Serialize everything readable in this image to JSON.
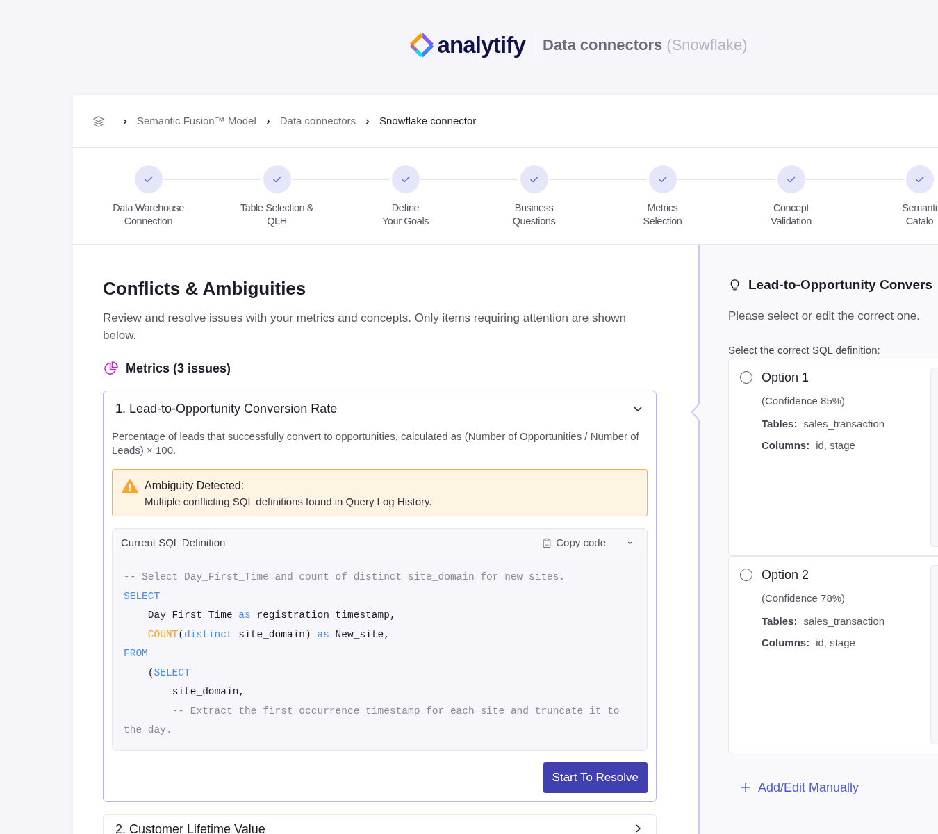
{
  "header": {
    "brand": "analytify",
    "title": "Data connectors",
    "subtitle": "(Snowflake)"
  },
  "breadcrumb": [
    "Semantic Fusion™ Model",
    "Data connectors",
    "Snowflake connector"
  ],
  "steps": [
    {
      "lines": [
        "Data Warehouse",
        "Connection"
      ],
      "completed": true
    },
    {
      "lines": [
        "Table Selection &",
        "QLH"
      ],
      "completed": true
    },
    {
      "lines": [
        "Define",
        "Your Goals"
      ],
      "completed": true
    },
    {
      "lines": [
        "Business",
        "Questions"
      ],
      "completed": true
    },
    {
      "lines": [
        "Metrics",
        "Selection"
      ],
      "completed": true
    },
    {
      "lines": [
        "Concept",
        "Validation"
      ],
      "completed": true
    },
    {
      "lines": [
        "Semanti",
        "Catalo"
      ],
      "completed": true
    }
  ],
  "main": {
    "title": "Conflicts & Ambiguities",
    "description": "Review and resolve issues with your metrics and concepts. Only items requiring attention are shown below.",
    "section": "Metrics (3 issues)",
    "metrics": [
      {
        "title": "1. Lead-to-Opportunity Conversion Rate",
        "expanded": true,
        "description": "Percentage of leads that successfully convert to opportunities, calculated as (Number of Opportunities / Number of Leads) × 100.",
        "alert": {
          "title": "Ambiguity Detected:",
          "message": "Multiple conflicting SQL definitions found in Query Log History."
        },
        "sql": {
          "label": "Current SQL Definition",
          "copy": "Copy code",
          "lines": [
            [
              {
                "kind": "comment",
                "text": "-- Select Day_First_Time and count of distinct site_domain for new sites."
              }
            ],
            [
              {
                "kind": "keyword",
                "text": "SELECT"
              }
            ],
            [
              {
                "kind": "plain",
                "text": "    Day_First_Time "
              },
              {
                "kind": "keyword",
                "text": "as"
              },
              {
                "kind": "plain",
                "text": " registration_timestamp,"
              }
            ],
            [
              {
                "kind": "function",
                "text": "    COUNT"
              },
              {
                "kind": "plain",
                "text": "("
              },
              {
                "kind": "keyword",
                "text": "distinct"
              },
              {
                "kind": "plain",
                "text": " site_domain) "
              },
              {
                "kind": "keyword",
                "text": "as"
              },
              {
                "kind": "plain",
                "text": " New_site,"
              }
            ],
            [
              {
                "kind": "keyword",
                "text": "FROM"
              }
            ],
            [
              {
                "kind": "plain",
                "text": "    ("
              },
              {
                "kind": "keyword",
                "text": "SELECT"
              }
            ],
            [
              {
                "kind": "plain",
                "text": "        site_domain,"
              }
            ],
            [
              {
                "kind": "comment",
                "text": "        -- Extract the first occurrence timestamp for each site and truncate it to the day."
              }
            ]
          ]
        },
        "button": "Start To Resolve"
      },
      {
        "title": "2. Customer Lifetime Value",
        "expanded": false
      }
    ]
  },
  "side": {
    "title": "Lead-to-Opportunity Convers",
    "hint": "Please select or edit the correct one.",
    "label": "Select the correct SQL definition:",
    "options": [
      {
        "title": "Option 1",
        "confidence": "(Confidence 85%)",
        "tables_label": "Tables:",
        "tables": "sales_transaction",
        "columns_label": "Columns:",
        "columns": "id, stage",
        "selected": false
      },
      {
        "title": "Option 2",
        "confidence": "(Confidence 78%)",
        "tables_label": "Tables:",
        "tables": "sales_transaction",
        "columns_label": "Columns:",
        "columns": "id, stage",
        "selected": false
      }
    ],
    "add": "Add/Edit Manually"
  }
}
